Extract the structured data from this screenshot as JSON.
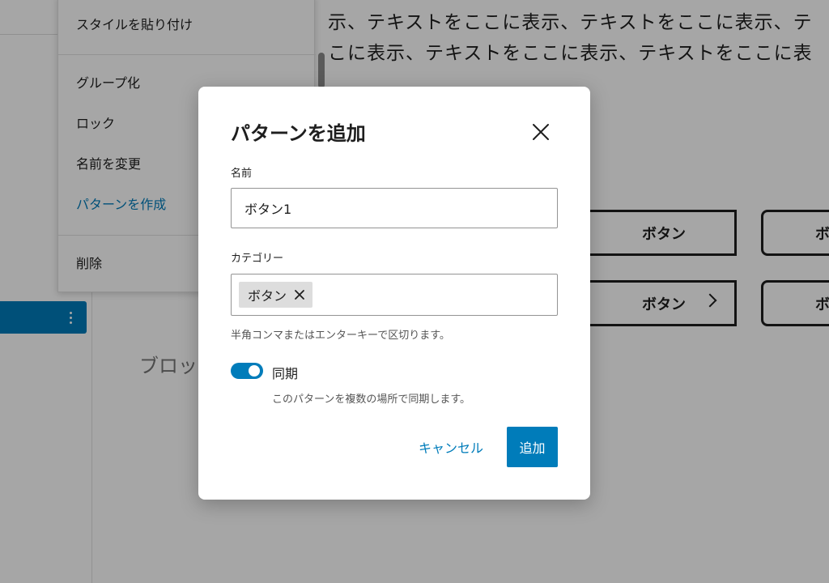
{
  "canvas": {
    "text_line_1": "示、テキストをここに表示、テキストをここに表示、テ",
    "text_line_2": "こに表示、テキストをここに表示、テキストをここに表",
    "block_hint": "ブロッ",
    "buttons": [
      {
        "label": "ボタン"
      },
      {
        "label": "ボタン"
      },
      {
        "label": "ボ"
      },
      {
        "label": "ボ"
      }
    ]
  },
  "context_menu": {
    "items": [
      {
        "label": "スタイルを貼り付け"
      },
      {
        "label": "グループ化"
      },
      {
        "label": "ロック"
      },
      {
        "label": "名前を変更"
      },
      {
        "label": "パターンを作成"
      },
      {
        "label": "削除"
      }
    ]
  },
  "modal": {
    "title": "パターンを追加",
    "name_label": "名前",
    "name_value": "ボタン1",
    "category_label": "カテゴリー",
    "category_chip": "ボタン",
    "category_help": "半角コンマまたはエンターキーで区切ります。",
    "sync_label": "同期",
    "sync_enabled": true,
    "sync_help": "このパターンを複数の場所で同期します。",
    "cancel_label": "キャンセル",
    "add_label": "追加"
  },
  "icons": {
    "close": "close-icon",
    "chip_remove": "close-small-icon",
    "row_options": "more-vertical-icon",
    "chevron": "chevron-right-icon"
  },
  "colors": {
    "accent": "#007cba",
    "overlay": "rgba(0,0,0,0.35)"
  }
}
